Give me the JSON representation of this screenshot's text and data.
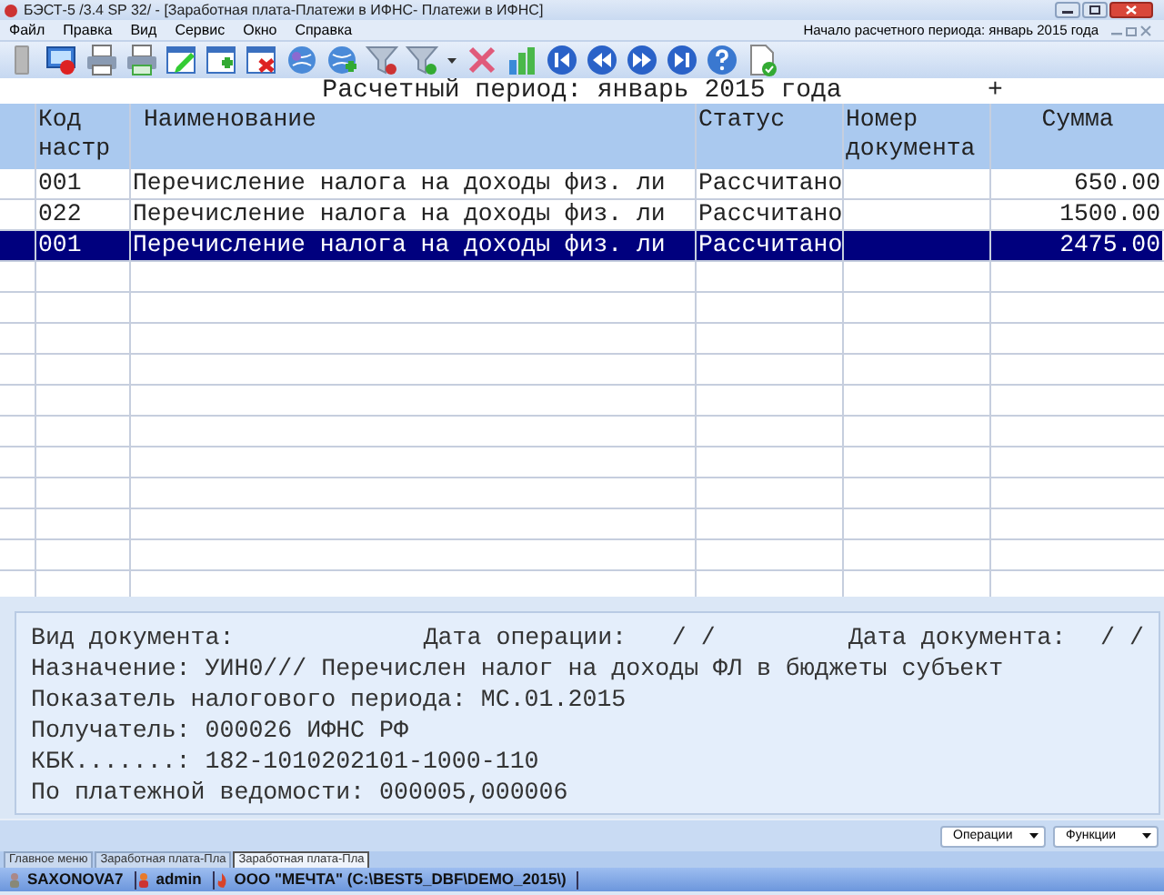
{
  "window": {
    "title": "БЭСТ-5 /3.4 SP 32/ - [Заработная плата-Платежи в ИФНС- Платежи в ИФНС]"
  },
  "menu": [
    "Файл",
    "Правка",
    "Вид",
    "Сервис",
    "Окно",
    "Справка"
  ],
  "period_start": "Начало расчетного периода: январь 2015 года",
  "period_title": "Расчетный период: январь 2015 года",
  "period_mark": "+",
  "table": {
    "columns": [
      "Код настр",
      "Наименование",
      "Статус",
      "Номер документа",
      "Сумма"
    ],
    "rows": [
      {
        "code": "001",
        "name": "Перечисление налога на доходы физ. ли",
        "status": "Рассчитано",
        "number": "",
        "sum": "650.00",
        "selected": false
      },
      {
        "code": "022",
        "name": "Перечисление налога на доходы физ. ли",
        "status": "Рассчитано",
        "number": "",
        "sum": "1500.00",
        "selected": false
      },
      {
        "code": "001",
        "name": "Перечисление налога на доходы физ. ли",
        "status": "Рассчитано",
        "number": "",
        "sum": "2475.00",
        "selected": true
      }
    ]
  },
  "details": {
    "doc_type": "Вид документа:",
    "op_date_label": "Дата операции:",
    "op_date": "/  /",
    "doc_date_label": "Дата документа:",
    "doc_date": "/  /",
    "lines": [
      "Назначение: УИН0/// Перечислен налог на доходы ФЛ в бюджеты субъект",
      "Показатель налогового периода: МС.01.2015",
      "Получатель: 000026 ИФНС РФ",
      "КБК.......: 182-1010202101-1000-110",
      "По платежной ведомости: 000005,000006"
    ]
  },
  "buttons": [
    "Операции",
    "Функции"
  ],
  "tabs": [
    {
      "label": "Главное меню",
      "selected": false
    },
    {
      "label": "Заработная плата-Пла",
      "selected": false
    },
    {
      "label": "Заработная плата-Пла",
      "selected": true
    }
  ],
  "status_bar": [
    "SAXONOVA7",
    "admin",
    "ООО \"МЕЧТА\" (C:\\BEST5_DBF\\DEMO_2015\\)"
  ]
}
